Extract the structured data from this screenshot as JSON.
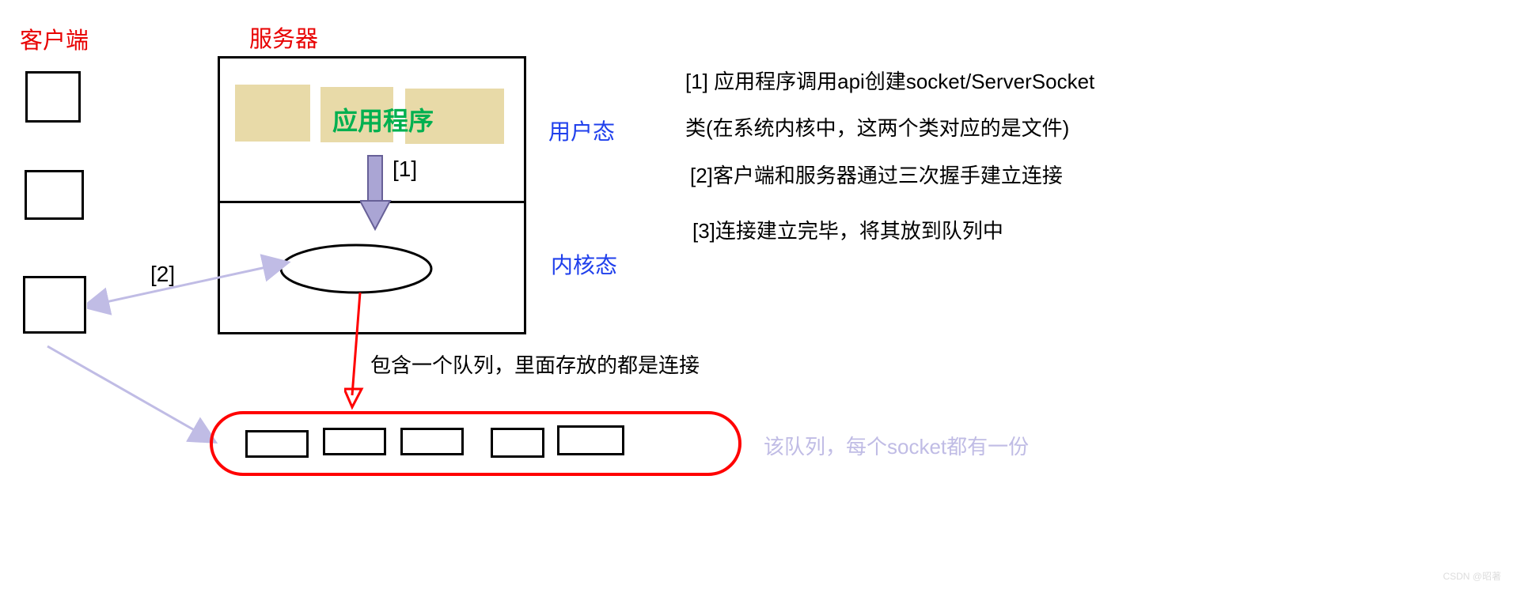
{
  "labels": {
    "client": "客户端",
    "server": "服务器",
    "app": "应用程序",
    "user_mode": "用户态",
    "kernel_mode": "内核态",
    "step1_ref": "[1]",
    "step2_ref": "[2]",
    "queue_desc": "包含一个队列，里面存放的都是连接",
    "queue_note": "该队列，每个socket都有一份",
    "explain1": "[1] 应用程序调用api创建socket/ServerSocket",
    "explain1b": "类(在系统内核中，这两个类对应的是文件)",
    "explain2": "[2]客户端和服务器通过三次握手建立连接",
    "explain3": "[3]连接建立完毕，将其放到队列中",
    "watermark": "CSDN @昭著"
  },
  "colors": {
    "red": "#e80000",
    "blue": "#2040ec",
    "green": "#00b050",
    "beige": "#e8daa8",
    "arrow_purple": "#aaa5d4",
    "arrow_red": "#ff0000",
    "lavender": "#c0bce5"
  }
}
